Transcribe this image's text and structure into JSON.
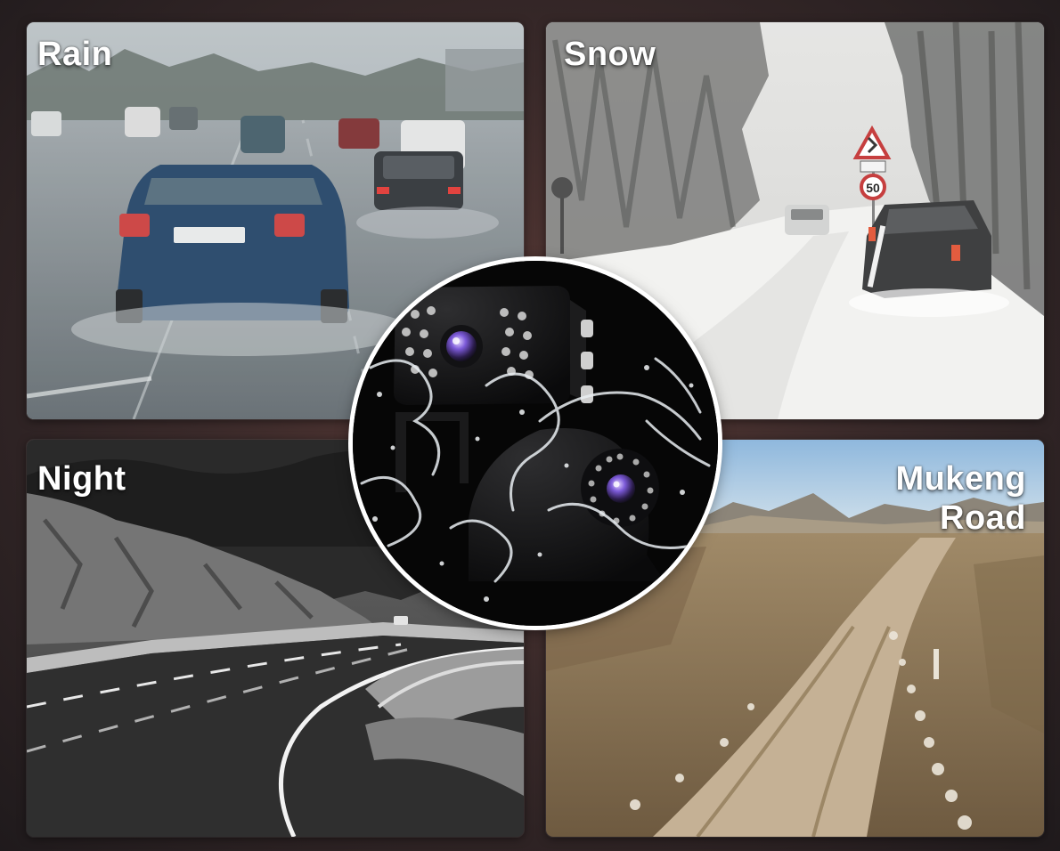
{
  "panels": {
    "rain": {
      "label": "Rain"
    },
    "snow": {
      "label": "Snow"
    },
    "night": {
      "label": "Night"
    },
    "mud": {
      "label_line1": "Mukeng",
      "label_line2": "Road"
    }
  },
  "road_sign": {
    "speed_limit": "50"
  },
  "colors": {
    "background": "#3a2a2a",
    "label_text": "#ffffff",
    "circle_border": "#ffffff"
  }
}
